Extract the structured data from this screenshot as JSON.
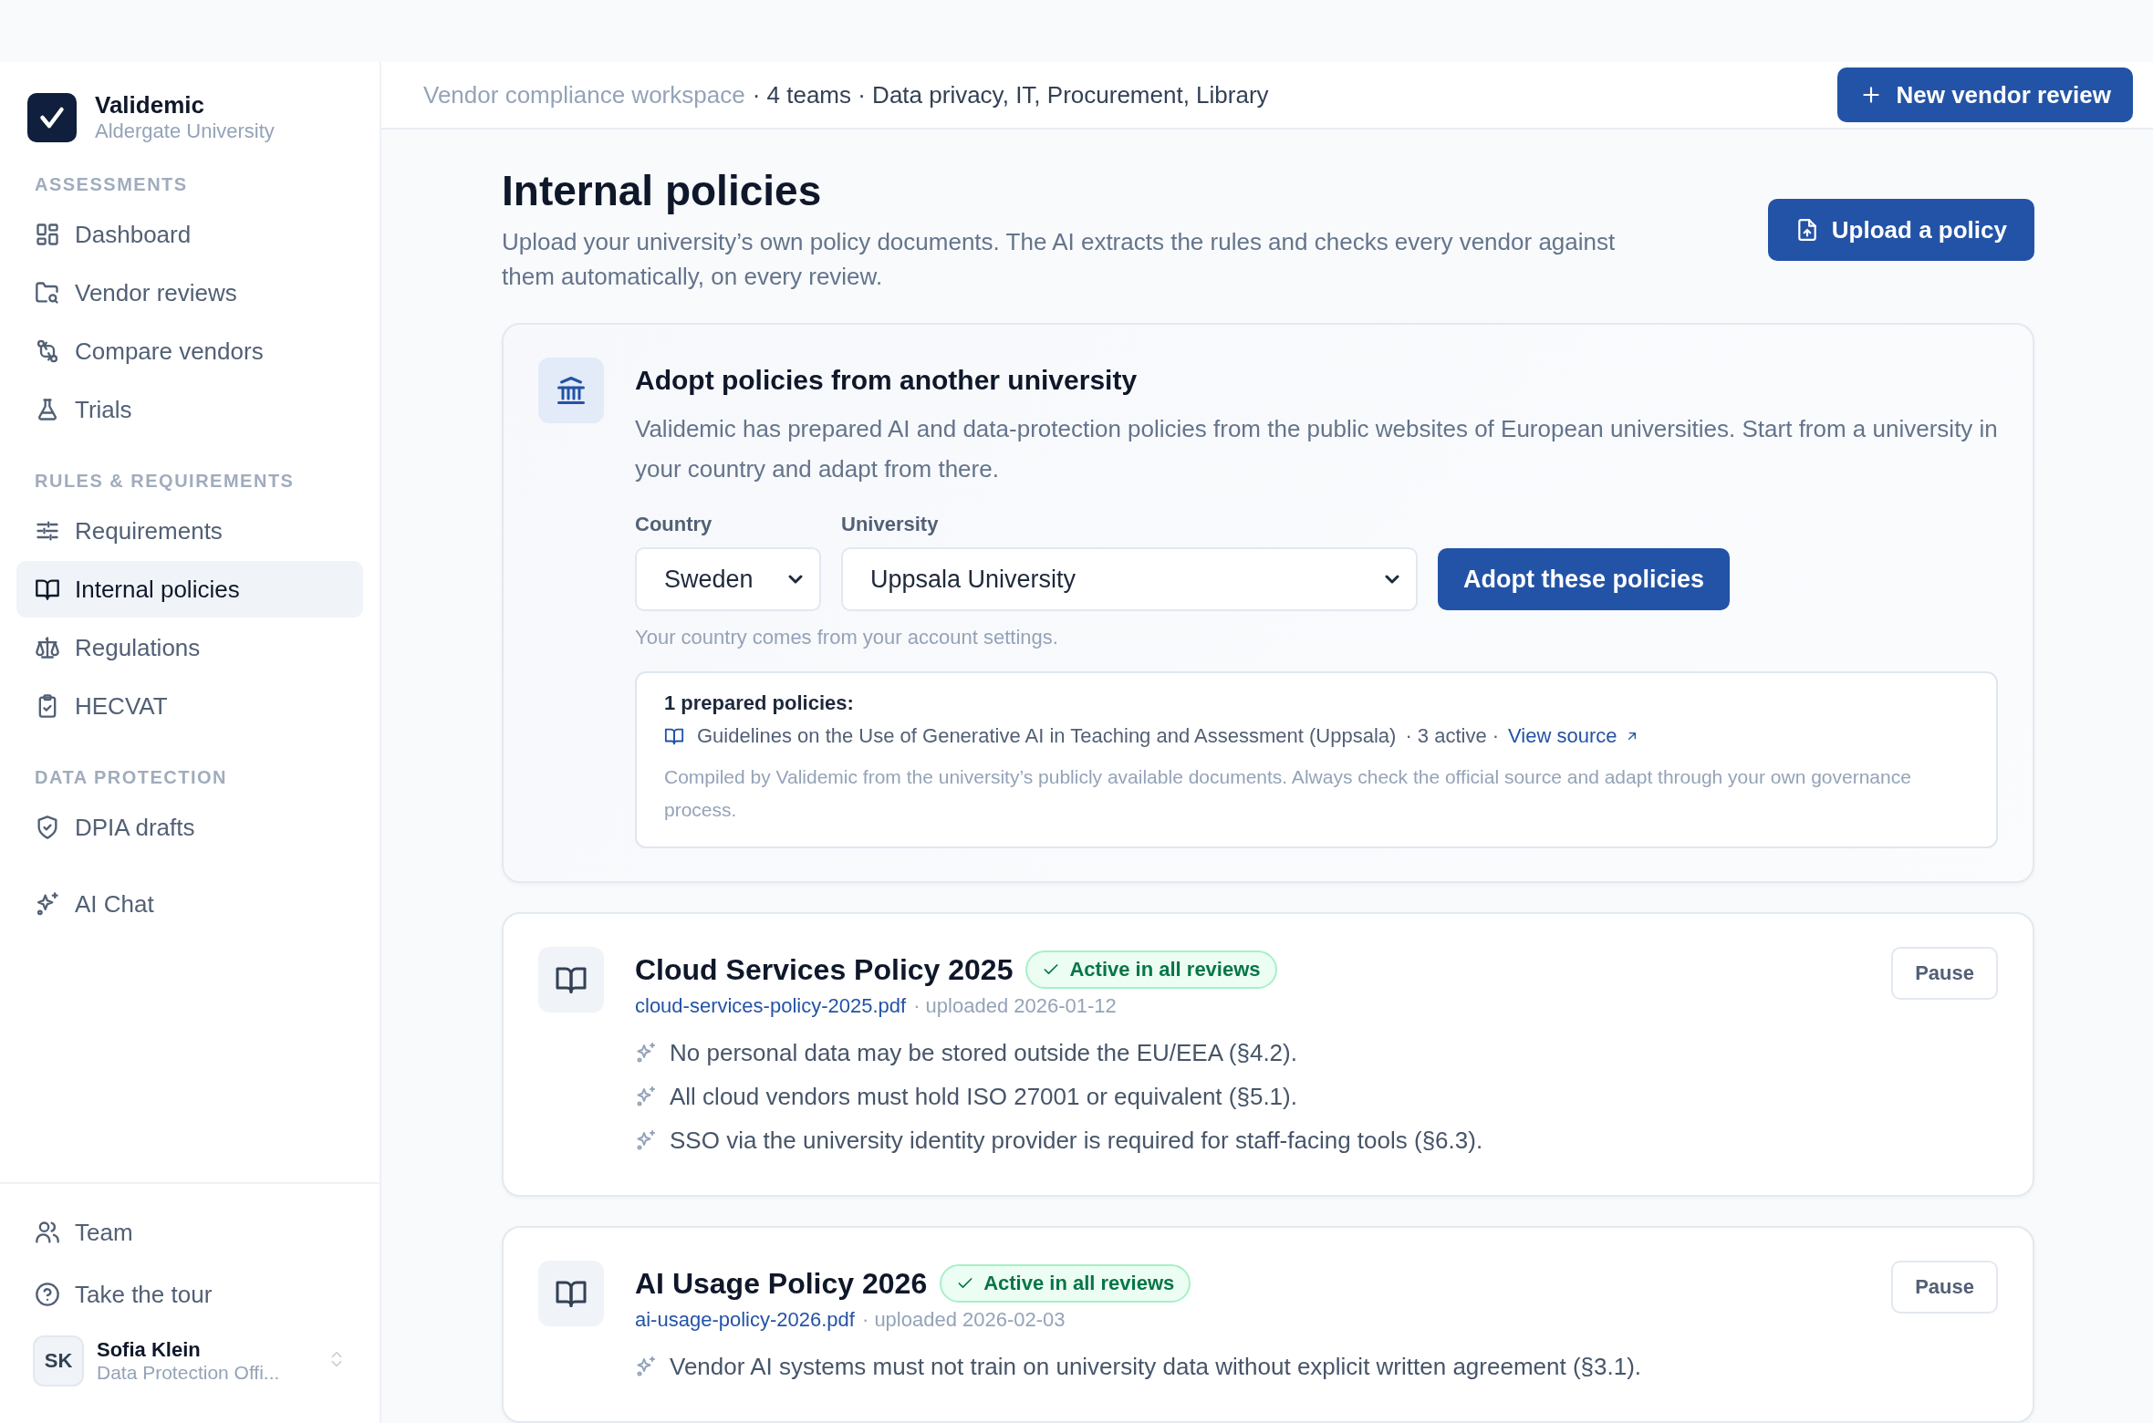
{
  "sidebar": {
    "brand": {
      "name": "Validemic",
      "org": "Aldergate University"
    },
    "sections": [
      {
        "label": "ASSESSMENTS",
        "items": [
          {
            "label": "Dashboard",
            "selected": false
          },
          {
            "label": "Vendor reviews",
            "selected": false
          },
          {
            "label": "Compare vendors",
            "selected": false
          },
          {
            "label": "Trials",
            "selected": false
          }
        ]
      },
      {
        "label": "RULES & REQUIREMENTS",
        "items": [
          {
            "label": "Requirements",
            "selected": false
          },
          {
            "label": "Internal policies",
            "selected": true
          },
          {
            "label": "Regulations",
            "selected": false
          },
          {
            "label": "HECVAT",
            "selected": false
          }
        ]
      },
      {
        "label": "DATA PROTECTION",
        "items": [
          {
            "label": "DPIA drafts",
            "selected": false
          }
        ]
      },
      {
        "items": [
          {
            "label": "AI Chat",
            "selected": false
          }
        ]
      }
    ],
    "footer_items": [
      {
        "label": "Team"
      },
      {
        "label": "Take the tour"
      }
    ],
    "user": {
      "initials": "SK",
      "name": "Sofia Klein",
      "role": "Data Protection Offi..."
    }
  },
  "header": {
    "workspace": "Vendor compliance workspace",
    "details": "· 4 teams · Data privacy, IT, Procurement, Library",
    "button": "New vendor review"
  },
  "page": {
    "title": "Internal policies",
    "description": "Upload your university’s own policy documents. The AI extracts the rules and checks every vendor against them automatically, on every review.",
    "upload_button": "Upload a policy"
  },
  "adopt": {
    "title": "Adopt policies from another university",
    "description": "Validemic has prepared AI and data-protection policies from the public websites of European universities. Start from a university in your country and adapt from there.",
    "country": {
      "label": "Country",
      "value": "Sweden"
    },
    "university": {
      "label": "University",
      "value": "Uppsala University"
    },
    "button": "Adopt these policies",
    "hint": "Your country comes from your account settings.",
    "prepared": {
      "heading": "1 prepared policies:",
      "items": [
        {
          "title": "Guidelines on the Use of Generative AI in Teaching and Assessment (Uppsala)",
          "meta": "· 3 active ·",
          "link": "View source"
        }
      ],
      "note": "Compiled by Validemic from the university’s publicly available documents. Always check the official source and adapt through your own governance process."
    }
  },
  "policies": [
    {
      "title": "Cloud Services Policy 2025",
      "status": "Active in all reviews",
      "active": true,
      "file": "cloud-services-policy-2025.pdf",
      "uploaded": "· uploaded 2026-01-12",
      "action": "Pause",
      "rules": [
        "No personal data may be stored outside the EU/EEA (§4.2).",
        "All cloud vendors must hold ISO 27001 or equivalent (§5.1).",
        "SSO via the university identity provider is required for staff-facing tools (§6.3)."
      ]
    },
    {
      "title": "AI Usage Policy 2026",
      "status": "Active in all reviews",
      "active": true,
      "file": "ai-usage-policy-2026.pdf",
      "uploaded": "· uploaded 2026-02-03",
      "action": "Pause",
      "rules": [
        "Vendor AI systems must not train on university data without explicit written agreement (§3.1)."
      ]
    }
  ]
}
